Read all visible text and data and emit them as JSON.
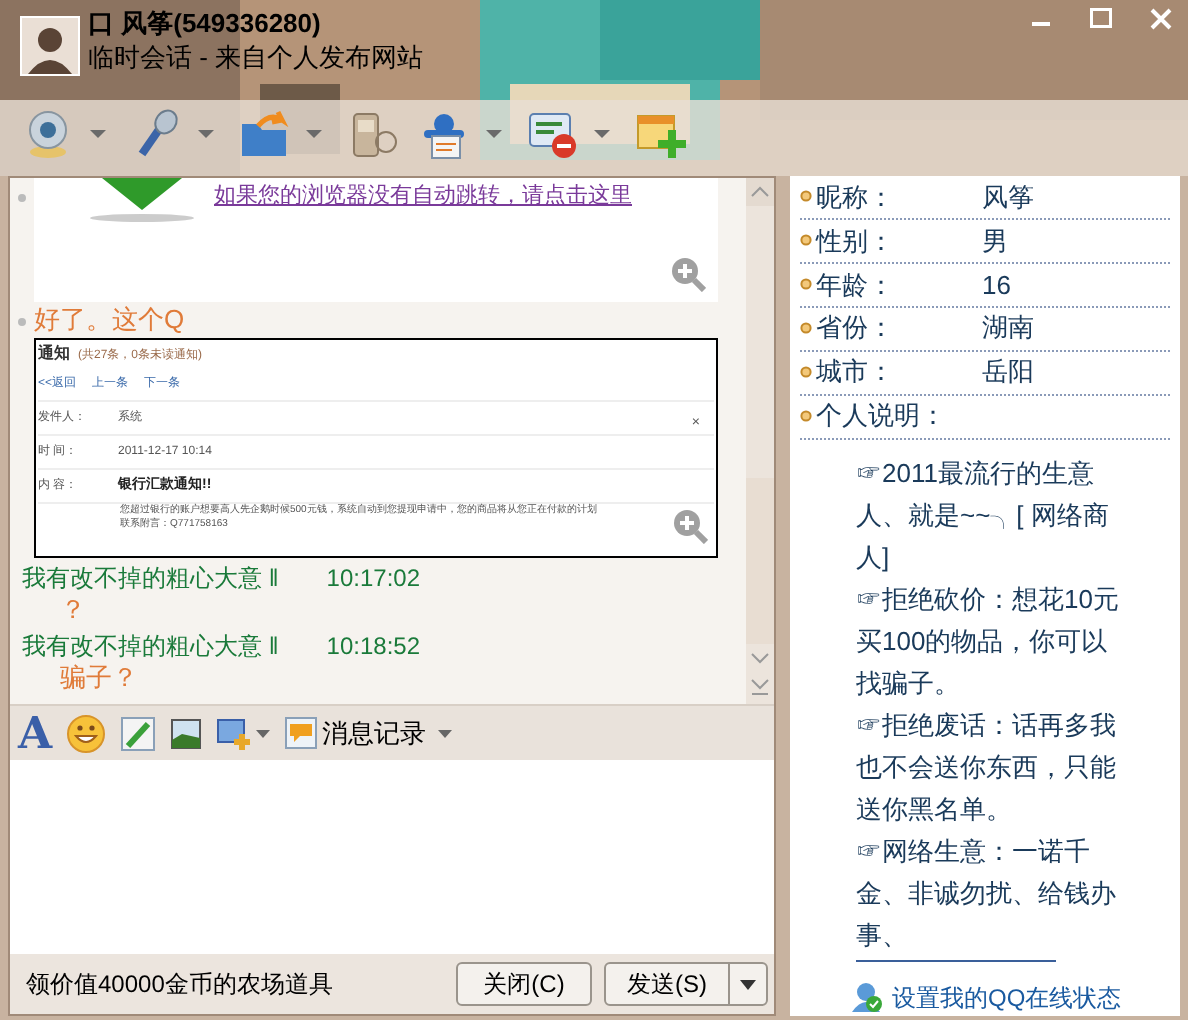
{
  "window": {
    "title": "口 风筝(549336280)",
    "subtitle": "临时会话 - 来自个人发布网站"
  },
  "toolbar": [
    {
      "kind": "camera",
      "dropdown": true
    },
    {
      "kind": "mic",
      "dropdown": true
    },
    {
      "kind": "folder",
      "dropdown": true
    },
    {
      "kind": "phone",
      "dropdown": false
    },
    {
      "kind": "meeting",
      "dropdown": true
    },
    {
      "kind": "block",
      "dropdown": true
    },
    {
      "kind": "add",
      "dropdown": false
    }
  ],
  "messages": [
    {
      "link": "如果您的浏览器没有自动跳转，请点击这里"
    },
    {
      "kind": "text",
      "text": "好了。这个Q"
    },
    {
      "kind": "screenshot",
      "title": "通知",
      "count": "(共27条，0条未读通知)",
      "nav": [
        "<<返回",
        "上一条",
        "下一条"
      ],
      "rows": [
        {
          "label": "发件人：",
          "value": "系统"
        },
        {
          "label": "时 间：",
          "value": "2011-12-17 10:14"
        },
        {
          "label": "内 容：",
          "value": "银行汇款通知!!"
        }
      ],
      "body": "您超过银行的账户想要高人先企鹅时候500元钱，系统自动到您提现申请中，您的商品将从您正在付款的计划",
      "contact": "联系附言：Q771758163",
      "close": "×"
    },
    {
      "kind": "message",
      "sender": "我有改不掉的粗心大意 ‖",
      "time": "10:17:02",
      "text": "？"
    },
    {
      "kind": "message",
      "sender": "我有改不掉的粗心大意 ‖",
      "time": "10:18:52",
      "text": "骗子？"
    }
  ],
  "format_bar": {
    "font_icon": "A",
    "history": "消息记录"
  },
  "status_bar": {
    "ad": "领价值40000金币的农场道具"
  },
  "buttons": [
    {
      "label": "关闭(C)",
      "kind": "plain"
    },
    {
      "label": "发送(S)",
      "kind": "split"
    }
  ],
  "profile": {
    "fields": [
      {
        "label": "昵称：",
        "value": "风筝"
      },
      {
        "label": "性别：",
        "value": "男"
      },
      {
        "label": "年龄：",
        "value": "16"
      },
      {
        "label": "省份：",
        "value": "湖南"
      },
      {
        "label": "城市：",
        "value": "岳阳"
      },
      {
        "label": "个人说明："
      }
    ],
    "bio": "☞2011最流行的生意人、就是~~╮[ 网络商人]\n☞拒绝砍价：想花10元买100的物品，你可以找骗子。\n☞拒绝废话：话再多我也不会送你东西，只能送你黑名单。\n☞网络生意：一诺千金、非诚勿扰、给钱办事、",
    "status_link": "设置我的QQ在线状态"
  }
}
